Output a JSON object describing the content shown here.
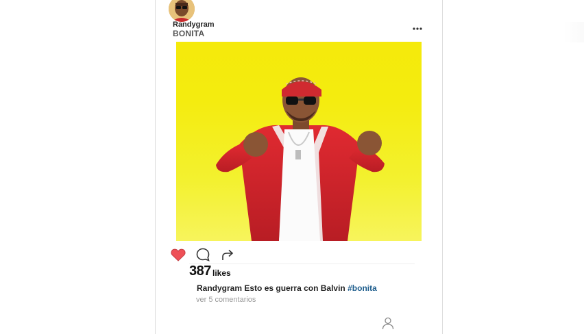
{
  "post": {
    "username": "Randygram",
    "title": "BONITA",
    "likes_count": "387",
    "likes_label": "likes",
    "caption_user": "Randygram",
    "caption_text": "Esto es guerra con Balvin",
    "hashtag": "#bonita",
    "comments_link": "ver 5 comentarios",
    "liked": true
  },
  "colors": {
    "image_background": "#f5ea0b",
    "like_heart": "#ee5057",
    "hashtag": "#1c5c8c",
    "jacket": "#d6242c"
  },
  "icons": {
    "more": "more-horizontal-icon",
    "like": "heart-icon",
    "comment": "comment-icon",
    "share": "share-arrow-icon",
    "profile": "profile-icon"
  }
}
